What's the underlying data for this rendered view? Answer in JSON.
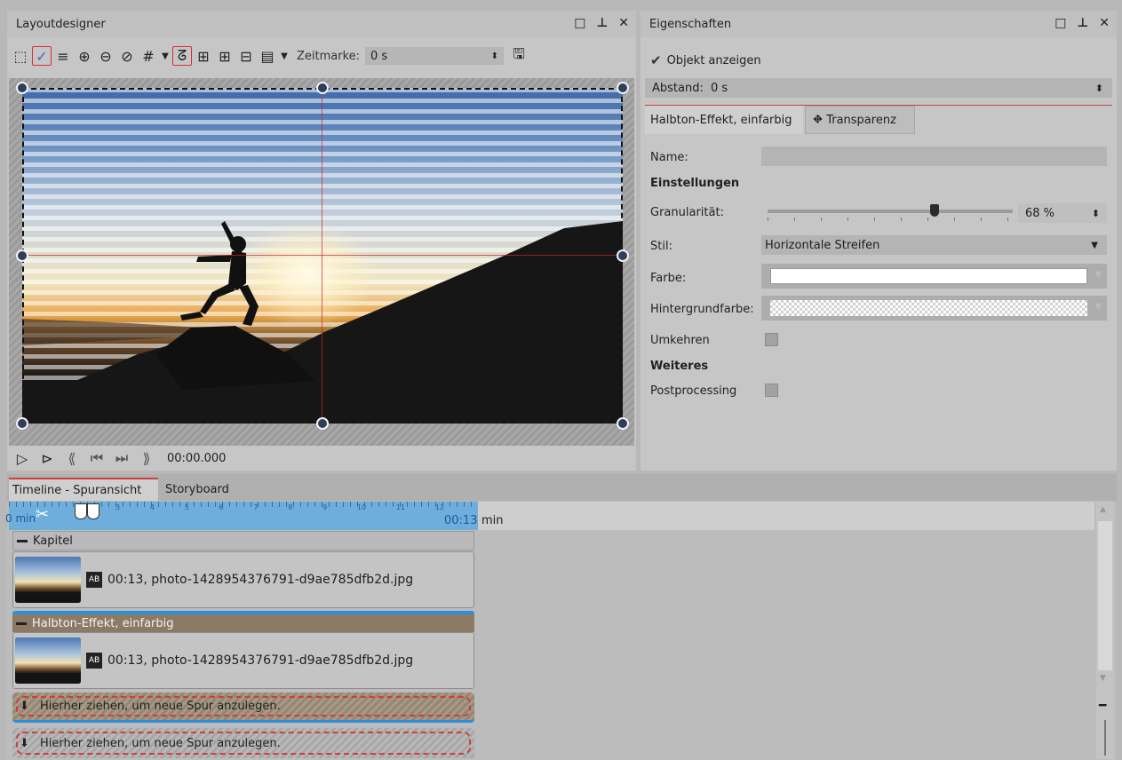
{
  "layout_panel": {
    "title": "Layoutdesigner",
    "timestamp_label": "Zeitmarke:",
    "timestamp_value": "0 s",
    "playback_time": "00:00.000"
  },
  "props_panel": {
    "title": "Eigenschaften",
    "show_object_label": "Objekt anzeigen",
    "distance_label": "Abstand:",
    "distance_value": "0 s",
    "tabs": [
      {
        "label": "Halbton-Effekt, einfarbig"
      },
      {
        "label": "Transparenz"
      }
    ],
    "name_label": "Name:",
    "name_value": "",
    "settings_heading": "Einstellungen",
    "granularity_label": "Granularität:",
    "granularity_value": "68 %",
    "granularity_fraction": 0.68,
    "style_label": "Stil:",
    "style_value": "Horizontale Streifen",
    "color_label": "Farbe:",
    "color_value": "#ffffff",
    "bgcolor_label": "Hintergrundfarbe:",
    "invert_label": "Umkehren",
    "more_heading": "Weiteres",
    "postprocessing_label": "Postprocessing"
  },
  "timeline": {
    "tabs": [
      {
        "label": "Timeline - Spuransicht"
      },
      {
        "label": "Storyboard"
      }
    ],
    "ruler_start": "0 min",
    "ruler_ticks": [
      "3",
      "4",
      "5",
      "6",
      "7",
      "8",
      "9",
      "10",
      "11",
      "12"
    ],
    "ruler_end_time": "00:13",
    "ruler_end_unit": "min",
    "chapter_label": "Kapitel",
    "clip1_label": "00:13, photo-1428954376791-d9ae785dfb2d.jpg",
    "effect_label": "Halbton-Effekt, einfarbig",
    "clip2_label": "00:13, photo-1428954376791-d9ae785dfb2d.jpg",
    "drop1_label": "Hierher ziehen, um neue Spur anzulegen.",
    "drop2_label": "Hierher ziehen, um neue Spur anzulegen."
  },
  "colors": {
    "accent_red": "#d03030",
    "ruler_blue": "#5aa0d8",
    "handle": "#2f3d5c"
  }
}
